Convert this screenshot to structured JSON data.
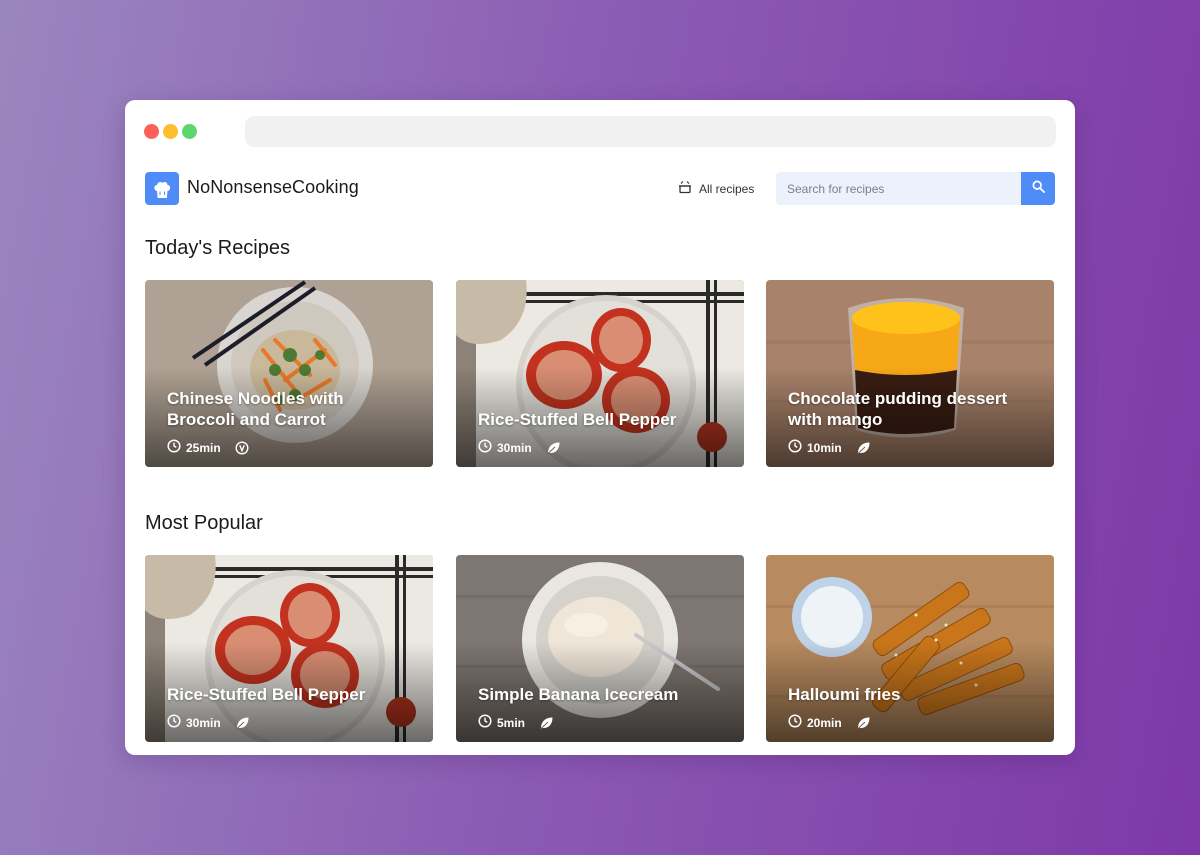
{
  "header": {
    "brand": "NoNonsenseCooking",
    "nav_all_recipes": "All recipes",
    "search_placeholder": "Search for recipes"
  },
  "sections": {
    "today_title": "Today's Recipes",
    "popular_title": "Most Popular"
  },
  "today": [
    {
      "title": "Chinese Noodles with Broccoli and Carrot",
      "time": "25min",
      "tag_icon": "vegan-v-icon"
    },
    {
      "title": "Rice-Stuffed Bell Pepper",
      "time": "30min",
      "tag_icon": "leaf-icon"
    },
    {
      "title": "Chocolate pudding dessert with mango",
      "time": "10min",
      "tag_icon": "leaf-icon"
    }
  ],
  "popular": [
    {
      "title": "Rice-Stuffed Bell Pepper",
      "time": "30min",
      "tag_icon": "leaf-icon"
    },
    {
      "title": "Simple Banana Icecream",
      "time": "5min",
      "tag_icon": "leaf-icon"
    },
    {
      "title": "Halloumi fries",
      "time": "20min",
      "tag_icon": "leaf-icon"
    }
  ],
  "colors": {
    "accent": "#4f8cf7",
    "search_bg": "#edf1fb",
    "text": "#1b1b1b"
  }
}
